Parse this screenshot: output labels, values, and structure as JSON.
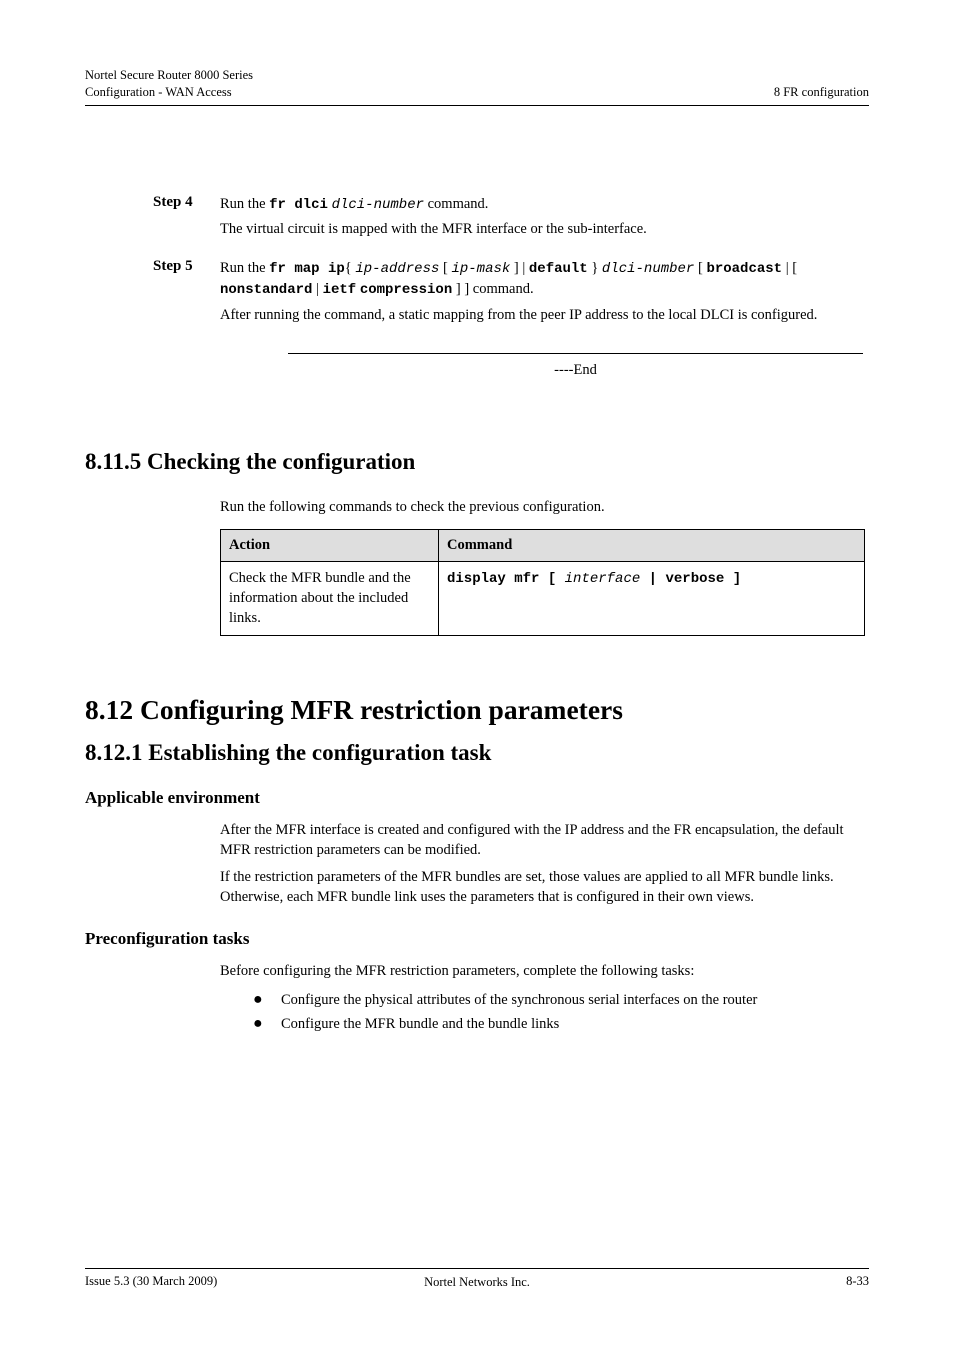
{
  "header": {
    "left_line1": "Nortel Secure Router 8000 Series",
    "left_line2": "Configuration - WAN Access",
    "right_line1": "8 FR configuration",
    "right_blank": " "
  },
  "steps": {
    "step4": {
      "label": "Step 4",
      "desc_prefix": "The virtual circuit is mapped with the MFR interface or the sub-interface.",
      "run_label": "Run the ",
      "cmd": "fr dlci",
      "arg": "dlci-number",
      "run_suffix": " command."
    },
    "step5": {
      "label": "Step 5",
      "run_label": "Run the ",
      "cmd": "fr map ip",
      "arg_open": "{ ",
      "arg1": "ip-address",
      "arg_mask_open": " [ ",
      "arg_mask": "ip-mask",
      "arg_mask_close": " ] | ",
      "arg_default": "default",
      "arg_close": " } ",
      "arg_dlci": "dlci-number",
      "opts_open": " [ ",
      "opt1": "broadcast",
      "opts_sep": " | [ ",
      "opt2a": "nonstandard",
      "opt2b": "ietf",
      "opt2_sep": " | ",
      "opt2c": "compression",
      "opts_close": " ] ]",
      "tail": " command.",
      "desc": "After running the command, a static mapping from the peer IP address to the local DLCI is configured."
    }
  },
  "end_text": "----End",
  "sec_8_11_5": {
    "title": "8.11.5 Checking the configuration",
    "intro": "Run the following commands to check the previous configuration.",
    "table": {
      "h1": "Action",
      "h2": "Command",
      "r1c1": "Check the MFR bundle and the information about the included links.",
      "r1c2_cmd": "display mfr",
      "r1c2_open": " [ ",
      "r1c2_a": "interface",
      "r1c2_sep": " | ",
      "r1c2_b": "verbose",
      "r1c2_close": " ]"
    }
  },
  "sec_8_12": {
    "title": "8.12 Configuring MFR restriction parameters"
  },
  "sec_8_12_1": {
    "title": "8.12.1 Establishing the configuration task",
    "env_head": "Applicable environment",
    "env_p1": "After the MFR interface is created and configured with the IP address and the FR encapsulation, the default MFR restriction parameters can be modified.",
    "env_p2": "If the restriction parameters of the MFR bundles are set, those values are applied to all MFR bundle links. Otherwise, each MFR bundle link uses the parameters that is configured in their own views.",
    "pre_head": "Preconfiguration tasks",
    "pre_intro": "Before configuring the MFR restriction parameters, complete the following tasks:",
    "b1": "Configure the physical attributes of the synchronous serial interfaces on the router",
    "b2": "Configure the MFR bundle and the bundle links"
  },
  "footer": {
    "left": "Issue 5.3 (30 March 2009)",
    "mid_line1": "Nortel Networks Inc.",
    "right": "8-33"
  }
}
